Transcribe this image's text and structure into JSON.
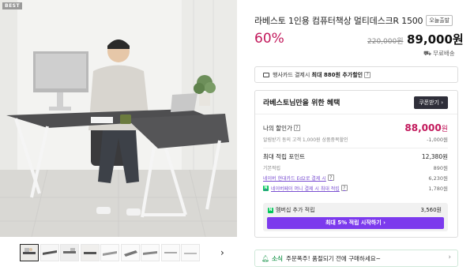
{
  "gallery": {
    "badge": "BEST",
    "thumbnails": [
      {
        "name": "thumb-1",
        "active": true
      },
      {
        "name": "thumb-2",
        "active": false
      },
      {
        "name": "thumb-3",
        "active": false
      },
      {
        "name": "thumb-4",
        "active": false
      },
      {
        "name": "thumb-5",
        "active": false
      },
      {
        "name": "thumb-6",
        "active": false
      },
      {
        "name": "thumb-7",
        "active": false
      },
      {
        "name": "thumb-8",
        "active": false
      },
      {
        "name": "thumb-9",
        "active": false
      },
      {
        "name": "thumb-10",
        "active": false
      }
    ],
    "next_icon": "chevron-right-icon"
  },
  "product": {
    "title": "라베스토 1인용 컴퓨터책상 멀티데스크R 1500",
    "today_badge": "오늘출발",
    "discount": "60%",
    "original_price": "220,000원",
    "price": "89,000원",
    "shipping": "무료배송"
  },
  "card_promo": {
    "prefix": "행사카드 결제시 ",
    "highlight": "최대 880원 추가할인",
    "help": "?"
  },
  "benefits": {
    "title": "라베스토님만을 위한 혜택",
    "coupon_button": "쿠폰받기",
    "my_price_label": "나의 할인가",
    "my_price_value": "88,000",
    "my_price_unit": "원",
    "alarm_label": "알림받기 동의 고객 1,000원 상품중복할인",
    "alarm_value": "-1,000원",
    "points_label": "최대 적립 포인트",
    "points_value": "12,380원",
    "basic_label": "기본적립",
    "basic_value": "890원",
    "hyundai_label": "네이버 현대카드 Ed2로 결제 시",
    "hyundai_value": "6,230원",
    "money_label": "네이버페이 머니 결제 시 최대 적립",
    "money_value": "1,780원",
    "member_label": "멤버십 추가 적립",
    "member_value": "3,560원",
    "member_button": "최대 5% 적립 시작하기"
  },
  "news": {
    "tag": "소식",
    "text": "주문폭주! 품절되기 전에 구매하세요~"
  },
  "colors": {
    "accent_pink": "#c2185b",
    "purple": "#7c3aed",
    "green": "#2e9e5b",
    "dark_button": "#2f2f3a"
  }
}
